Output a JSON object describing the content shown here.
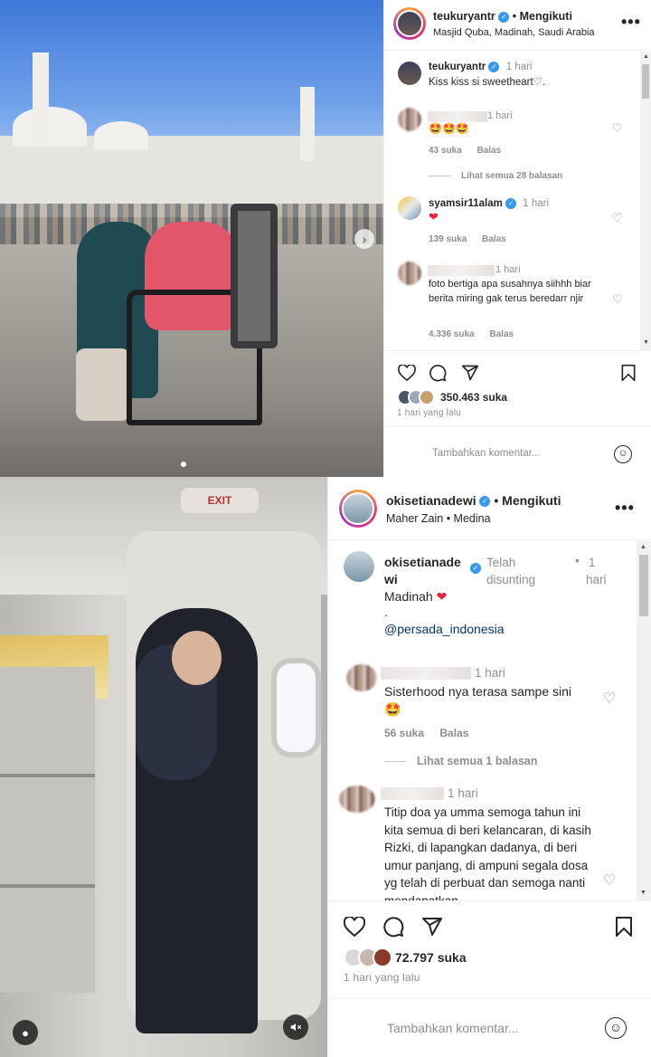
{
  "post1": {
    "header": {
      "username": "teukuryantr",
      "follow": "Mengikuti",
      "location": "Masjid Quba, Madinah, Saudi Arabia"
    },
    "caption": {
      "username": "teukuryantr",
      "time": "1 hari",
      "text": "Kiss kiss si sweetheart♡."
    },
    "comments": [
      {
        "username": "",
        "time": "1 hari",
        "text": "🤩🤩🤩",
        "likes": "43 suka",
        "reply": "Balas"
      },
      {
        "username": "syamsir11alam",
        "time": "1 hari",
        "text": "❤",
        "likes": "139 suka",
        "reply": "Balas"
      },
      {
        "username": "",
        "time": "1 hari",
        "text": "foto bertiga apa susahnya siihhh biar berita miring gak terus beredarr njir",
        "likes": "4.336 suka",
        "reply": "Balas"
      }
    ],
    "view_replies": "Lihat semua 28 balasan",
    "likes": "350.463 suka",
    "date": "1 hari yang lalu",
    "add_comment_placeholder": "Tambahkan komentar..."
  },
  "post2": {
    "header": {
      "username": "okisetianadewi",
      "follow": "Mengikuti",
      "location": "Maher Zain • Medina"
    },
    "caption": {
      "username_line1": "okisetianade",
      "username_line2": "wi",
      "edited_line1": "Telah",
      "edited_line2": "disunting",
      "bullet": "•",
      "time_line1": "1",
      "time_line2": "hari",
      "text": "Madinah",
      "dot": ".",
      "mention": "@persada_indonesia"
    },
    "comments": [
      {
        "time": "1 hari",
        "text": "Sisterhood nya terasa sampe sini",
        "emoji": "🤩",
        "likes": "56 suka",
        "reply": "Balas"
      },
      {
        "time": "1 hari",
        "text": "Titip doa ya umma semoga tahun ini kita semua di beri kelancaran, di kasih Rizki, di lapangkan dadanya, di beri umur panjang, di ampuni segala dosa yg telah di perbuat dan semoga nanti mendapatkan"
      }
    ],
    "view_replies": "Lihat semua 1 balasan",
    "likes": "72.797 suka",
    "date": "1 hari yang lalu",
    "add_comment_placeholder": "Tambahkan komentar...",
    "exit_sign": "EXIT"
  },
  "icons": {
    "heart": "♡",
    "comment": "comment-icon",
    "share": "share-icon",
    "save": "bookmark-icon",
    "more": "•••",
    "verified": "✓",
    "next": "›"
  },
  "colors": {
    "verified": "#3897f0",
    "link": "#00376b",
    "heart_red": "#ed1f3c",
    "secondary": "#8e8e8e"
  }
}
